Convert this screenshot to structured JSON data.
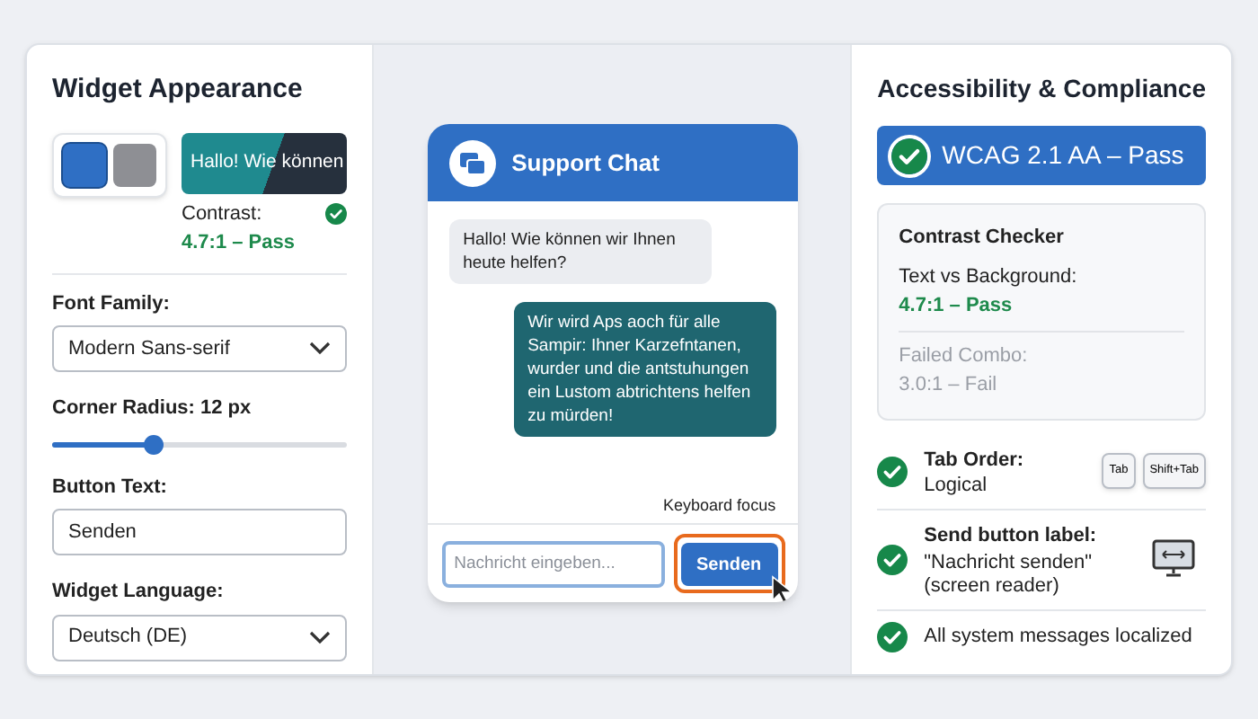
{
  "appearance": {
    "title": "Widget Appearance",
    "swatches": [
      {
        "color": "#2f6fc4",
        "selected": true
      },
      {
        "color": "#8e8f94",
        "selected": false
      }
    ],
    "preview_text": "Hallo! Wie können",
    "contrast_label": "Contrast:",
    "contrast_value": "4.7:1 – Pass",
    "font_family": {
      "label": "Font Family:",
      "value": "Modern Sans-serif"
    },
    "corner_radius": {
      "label": "Corner Radius: 12 px",
      "level": 0.34
    },
    "button_text": {
      "label": "Button Text:",
      "value": "Senden"
    },
    "language": {
      "label": "Widget Language:",
      "value": "Deutsch (DE)"
    }
  },
  "chat": {
    "title": "Support Chat",
    "messages": [
      {
        "kind": "incoming",
        "text": "Hallo! Wie können wir Ihnen heute helfen?"
      },
      {
        "kind": "outgoing",
        "text": "Wir wird Aps aoch für alle Sampir: Ihner Karzefntanen, wurder und die antstuhungen ein Lustom abtrichtens helfen zu mürden!"
      }
    ],
    "focus_note": "Keyboard focus",
    "input_placeholder": "Nachricht eingeben...",
    "send_label": "Senden",
    "send_focused": true
  },
  "compliance": {
    "title": "Accessibility & Compliance",
    "badge": "WCAG 2.1 AA – Pass",
    "checker": {
      "title": "Contrast Checker",
      "pass_label": "Text vs Background:",
      "pass_value": "4.7:1 – Pass",
      "fail_label": "Failed Combo:",
      "fail_value": "3.0:1 – Fail"
    },
    "checks": [
      {
        "kind": "keys",
        "title": "Tab Order:",
        "detail": "Logical",
        "keys": [
          "Tab",
          "Shift+Tab"
        ]
      },
      {
        "kind": "monitor",
        "title": "Send button label:",
        "detail": "\"Nachricht senden\" (screen reader)"
      },
      {
        "kind": "plain",
        "detail": "All system messages localized"
      }
    ]
  }
}
